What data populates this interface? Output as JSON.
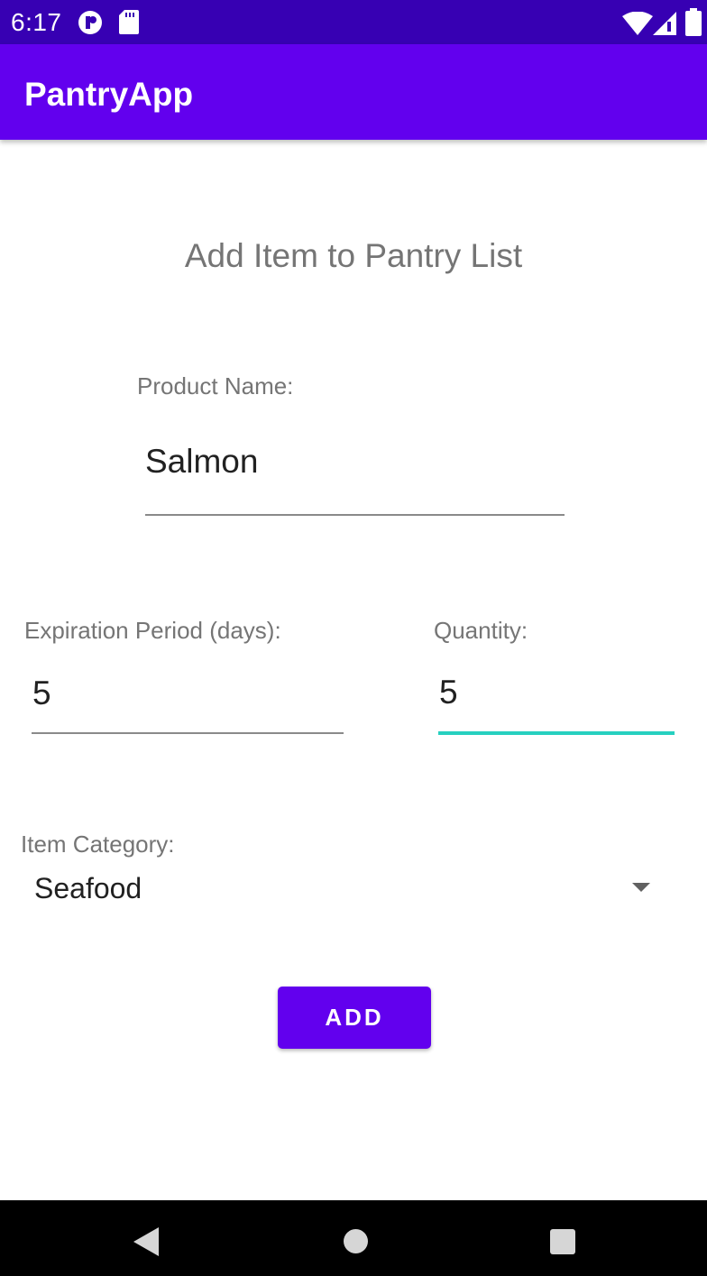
{
  "status_bar": {
    "time": "6:17",
    "icons": [
      "app-notification-icon",
      "sd-card-icon",
      "wifi-icon",
      "cell-signal-icon",
      "battery-icon"
    ]
  },
  "app_bar": {
    "title": "PantryApp"
  },
  "form": {
    "heading": "Add Item to Pantry List",
    "product_name": {
      "label": "Product Name:",
      "value": "Salmon"
    },
    "expiration": {
      "label": "Expiration Period (days):",
      "value": "5"
    },
    "quantity": {
      "label": "Quantity:",
      "value": "5"
    },
    "category": {
      "label": "Item Category:",
      "selected": "Seafood"
    },
    "add_button_label": "ADD"
  },
  "colors": {
    "status_bar": "#3700b3",
    "primary": "#6200ee",
    "focus_accent": "#26d0c0"
  },
  "nav_bar": {
    "buttons": [
      "back-icon",
      "home-icon",
      "recents-icon"
    ]
  }
}
